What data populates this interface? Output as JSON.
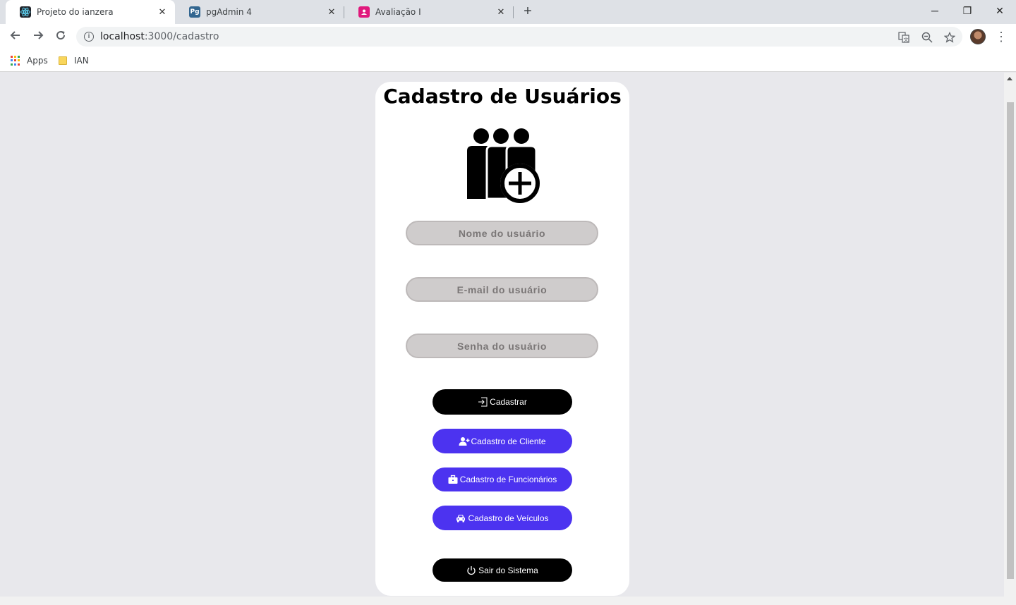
{
  "browser": {
    "tabs": [
      {
        "title": "Projeto do ianzera",
        "active": true
      },
      {
        "title": "pgAdmin 4",
        "favicon_text": "Pg",
        "active": false
      },
      {
        "title": "Avaliação I",
        "active": false
      }
    ],
    "url_host": "localhost",
    "url_path": ":3000/cadastro",
    "bookmarks": [
      {
        "label": "Apps",
        "icon": "apps-grid-icon"
      },
      {
        "label": "IAN",
        "icon": "folder-icon"
      }
    ],
    "window_controls": {
      "minimize": "─",
      "restore": "❐",
      "close": "✕"
    }
  },
  "page": {
    "title": "Cadastro de Usuários",
    "hero_icon": "users-add-icon",
    "fields": [
      {
        "name": "nome",
        "placeholder": "Nome do usuário",
        "value": ""
      },
      {
        "name": "email",
        "placeholder": "E-mail do usuário",
        "value": ""
      },
      {
        "name": "senha",
        "placeholder": "Senha do usuário",
        "value": ""
      }
    ],
    "buttons": {
      "cadastrar": {
        "label": "Cadastrar",
        "icon": "sign-in-icon"
      },
      "cliente": {
        "label": "Cadastro de Cliente",
        "icon": "user-plus-icon"
      },
      "funcionarios": {
        "label": "Cadastro de Funcionários",
        "icon": "briefcase-icon"
      },
      "veiculos": {
        "label": "Cadastro de Veículos",
        "icon": "car-icon"
      },
      "sair": {
        "label": "Sair do Sistema",
        "icon": "power-icon"
      }
    }
  },
  "colors": {
    "accent": "#4c33f0",
    "field_bg": "#cfcccc",
    "page_bg": "#e8e8ec"
  }
}
